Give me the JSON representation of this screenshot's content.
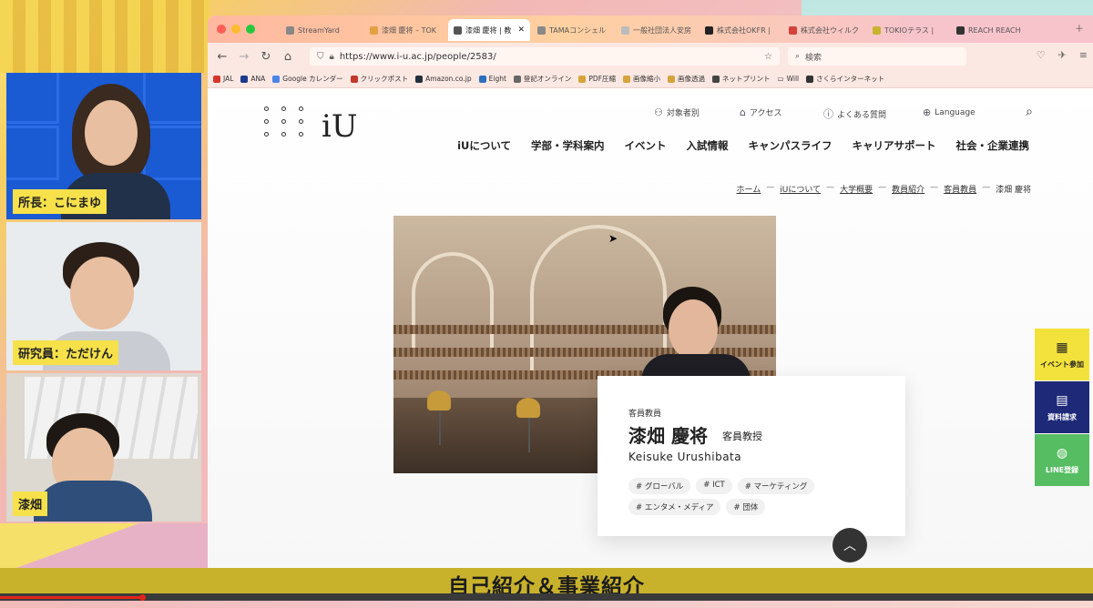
{
  "participants": [
    {
      "name": "所長：こにまゆ"
    },
    {
      "name": "研究員：ただけん"
    },
    {
      "name": "漆畑"
    }
  ],
  "browser": {
    "tabs": [
      {
        "label": "StreamYard",
        "active": false
      },
      {
        "label": "漆畑 慶将 – TOK",
        "active": false
      },
      {
        "label": "漆畑 慶将 | 教",
        "active": true
      },
      {
        "label": "TAMAコンシェル",
        "active": false
      },
      {
        "label": "一般社団法人安房",
        "active": false
      },
      {
        "label": "株式会社OKFR |",
        "active": false
      },
      {
        "label": "株式会社ウィルク",
        "active": false
      },
      {
        "label": "TOKIOテラス | ",
        "active": false
      },
      {
        "label": "REACH REACH",
        "active": false
      }
    ],
    "url": "https://www.i-u.ac.jp/people/2583/",
    "search_placeholder": "検索",
    "bookmarks": [
      "JAL",
      "ANA",
      "Google カレンダー",
      "クリックポスト",
      "Amazon.co.jp",
      "Eight",
      "登記オンライン",
      "PDF圧縮",
      "画像縮小",
      "画像透過",
      "ネットプリント",
      "Will",
      "さくらインターネット"
    ]
  },
  "site": {
    "logo": "iU",
    "utility": [
      "対象者別",
      "アクセス",
      "よくある質問",
      "Language"
    ],
    "nav": [
      "iUについて",
      "学部・学科案内",
      "イベント",
      "入試情報",
      "キャンパスライフ",
      "キャリアサポート",
      "社会・企業連携"
    ],
    "breadcrumb": [
      "ホーム",
      "iUについて",
      "大学概要",
      "教員紹介",
      "客員教員",
      "漆畑 慶将"
    ],
    "profile": {
      "role": "客員教員",
      "name": "漆畑 慶将",
      "title": "客員教授",
      "romaji": "Keisuke Urushibata",
      "tags": [
        "グローバル",
        "ICT",
        "マーケティング",
        "エンタメ・メディア",
        "団体"
      ]
    },
    "side_buttons": [
      "イベント参加",
      "資料請求",
      "LINE登録"
    ]
  },
  "caption": "自己紹介＆事業紹介",
  "video_progress": 0.13
}
